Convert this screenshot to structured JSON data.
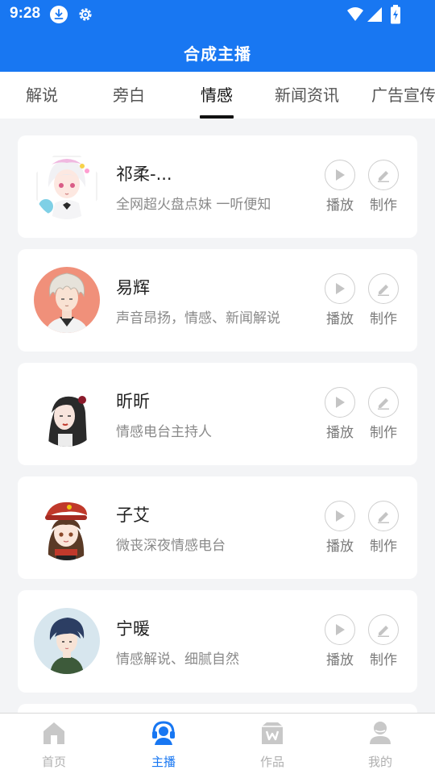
{
  "status_bar": {
    "time": "9:28",
    "icons": [
      "download-icon",
      "gear-icon",
      "wifi-icon",
      "signal-icon",
      "battery-charging-icon"
    ]
  },
  "header": {
    "title": "合成主播"
  },
  "tabs": [
    {
      "label": "解说",
      "active": false
    },
    {
      "label": "旁白",
      "active": false
    },
    {
      "label": "情感",
      "active": true
    },
    {
      "label": "新闻资讯",
      "active": false
    },
    {
      "label": "广告宣传",
      "active": false
    }
  ],
  "anchors": [
    {
      "name": "祁柔-...",
      "description": "全网超火盘点妹 一听便知",
      "play_label": "播放",
      "make_label": "制作"
    },
    {
      "name": "易辉",
      "description": "声音昂扬，情感、新闻解说",
      "play_label": "播放",
      "make_label": "制作"
    },
    {
      "name": "昕昕",
      "description": "情感电台主持人",
      "play_label": "播放",
      "make_label": "制作"
    },
    {
      "name": "子艾",
      "description": "微丧深夜情感电台",
      "play_label": "播放",
      "make_label": "制作"
    },
    {
      "name": "宁暖",
      "description": "情感解说、细腻自然",
      "play_label": "播放",
      "make_label": "制作"
    }
  ],
  "bottom_nav": [
    {
      "label": "首页",
      "icon": "home-icon",
      "active": false
    },
    {
      "label": "主播",
      "icon": "headset-icon",
      "active": true
    },
    {
      "label": "作品",
      "icon": "works-icon",
      "active": false
    },
    {
      "label": "我的",
      "icon": "profile-icon",
      "active": false
    }
  ],
  "colors": {
    "primary": "#1877f2",
    "page_bg": "#f3f4f6",
    "card_bg": "#ffffff",
    "text_primary": "#222222",
    "text_secondary": "#8a8a8a",
    "nav_inactive": "#b0b0b0"
  }
}
